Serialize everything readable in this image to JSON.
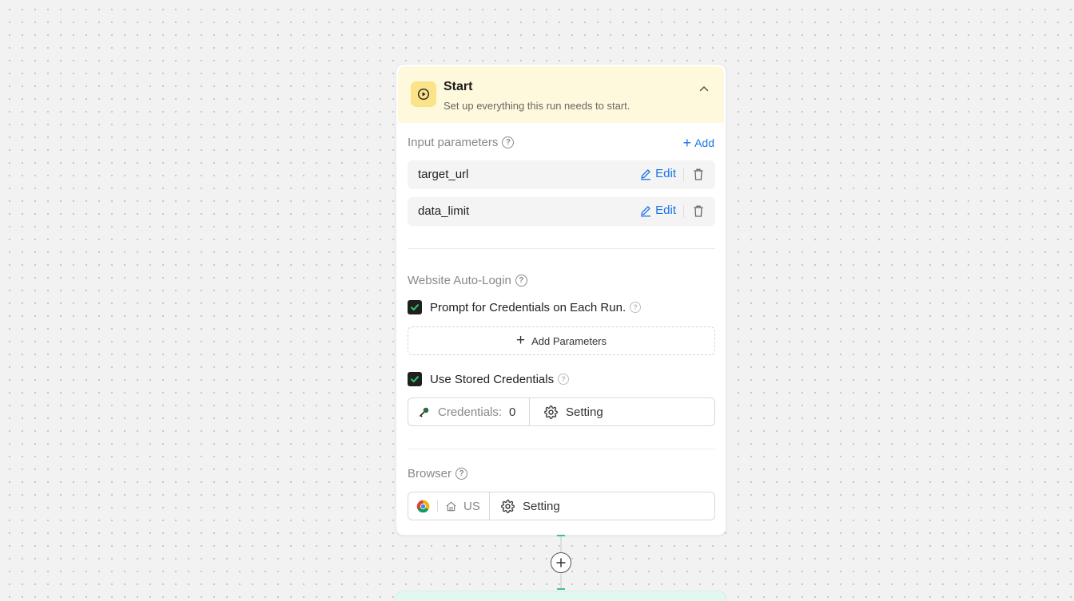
{
  "start_node": {
    "title": "Start",
    "subtitle": "Set up everything this run needs to start.",
    "input_parameters": {
      "label": "Input parameters",
      "add_label": "Add",
      "items": [
        {
          "name": "target_url",
          "edit_label": "Edit"
        },
        {
          "name": "data_limit",
          "edit_label": "Edit"
        }
      ]
    },
    "auto_login": {
      "label": "Website Auto-Login",
      "prompt_checkbox": {
        "label": "Prompt for Credentials on Each Run.",
        "checked": true
      },
      "add_parameters_label": "Add Parameters",
      "stored_checkbox": {
        "label": "Use Stored Credentials",
        "checked": true
      },
      "credentials_label": "Credentials:",
      "credentials_count": "0",
      "setting_label": "Setting"
    },
    "browser": {
      "label": "Browser",
      "region": "US",
      "setting_label": "Setting"
    }
  },
  "colors": {
    "header_bg": "#fef9dc",
    "icon_bg": "#fbe38a",
    "link_blue": "#1a73e8",
    "check_green": "#2ecc71",
    "next_node_bg": "#e2f8ee"
  },
  "icons": [
    "play-icon",
    "chevron-up-icon",
    "help-icon",
    "plus-icon",
    "pencil-icon",
    "trash-icon",
    "check-icon",
    "key-icon",
    "gear-icon",
    "chrome-icon",
    "home-icon"
  ]
}
